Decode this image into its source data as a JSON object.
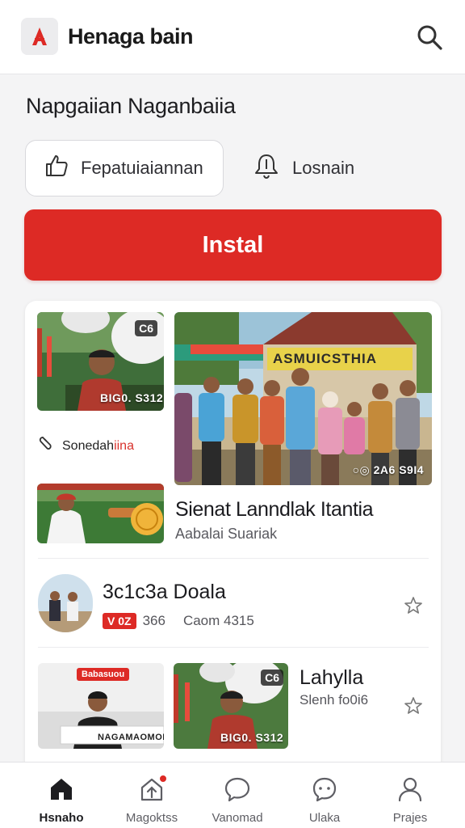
{
  "header": {
    "app_title": "Henaga bain",
    "logo_icon": "app-logo-icon",
    "search_icon": "search-icon"
  },
  "page": {
    "title": "Napgaiian Naganbaiia"
  },
  "actions": {
    "primary_outline_label": "Fepatuiaiannan",
    "primary_outline_icon": "thumbs-up-icon",
    "secondary_label": "Losnain",
    "secondary_icon": "bell-icon",
    "install_label": "Instal"
  },
  "feed": {
    "thumb1_badge": "C6",
    "thumb1_overlay": "BIG0. S312",
    "group_photo_banner": "ASMUICSTHIA",
    "group_photo_overlay": "○◎ 2A6 S9I4",
    "tag_label": "Sonedahiina",
    "tag_label_plain": "Sonedah",
    "tag_label_accent": "iina",
    "story_title": "Sienat Lanndlak Itantia",
    "story_subtitle": "Aabalai Suariak",
    "row2": {
      "title": "3c1c3a  Doala",
      "chip": "V 0Z",
      "meta_num": "366",
      "meta_text": "Caom 4315"
    },
    "row3": {
      "thumb_label": "Babasuou",
      "thumb_caption": "NAGAMAOMOEI",
      "thumb2_badge": "C6",
      "thumb2_overlay": "BIG0. S312",
      "title": "Lahylla",
      "meta_text": "Slenh fo0i6"
    }
  },
  "bottom_nav": {
    "items": [
      {
        "label": "Hsnaho",
        "icon": "home-icon"
      },
      {
        "label": "Magoktss",
        "icon": "upload-icon"
      },
      {
        "label": "Vanomad",
        "icon": "chat-icon"
      },
      {
        "label": "Ulaka",
        "icon": "message-icon"
      },
      {
        "label": "Prajes",
        "icon": "profile-icon"
      }
    ]
  },
  "colors": {
    "accent": "#dd2a25",
    "background": "#f4f4f5",
    "surface": "#ffffff"
  }
}
